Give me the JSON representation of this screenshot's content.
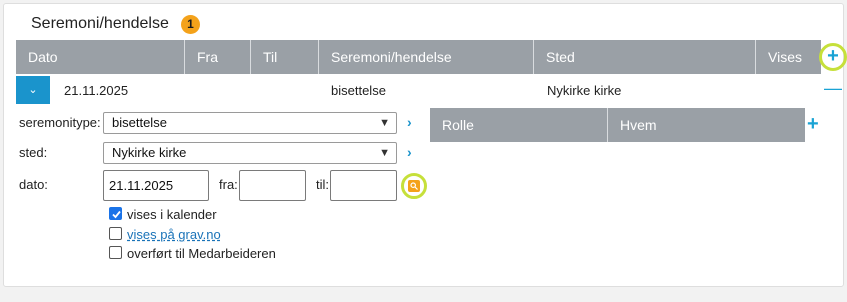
{
  "section": {
    "title": "Seremoni/hendelse",
    "badge": "1"
  },
  "table": {
    "columns": [
      "Dato",
      "Fra",
      "Til",
      "Seremoni/hendelse",
      "Sted",
      "Vises"
    ],
    "add_icon": "plus-icon",
    "row": {
      "dato": "21.11.2025",
      "fra": "",
      "til": "",
      "seremoni": "bisettelse",
      "sted": "Nykirke kirke",
      "expand_icon": "chevron-down-icon",
      "collapse_icon": "minus-icon"
    }
  },
  "form": {
    "seremonitype_label": "seremonitype:",
    "seremonitype_value": "bisettelse",
    "sted_label": "sted:",
    "sted_value": "Nykirke kirke",
    "dato_label": "dato:",
    "dato_value": "21.11.2025",
    "fra_label": "fra:",
    "fra_value": "",
    "til_label": "til:",
    "til_value": "",
    "checkboxes": {
      "kalender_label": "vises i kalender",
      "kalender_checked": true,
      "grav_label": "vises på grav.no",
      "grav_checked": false,
      "medarbeider_label": "overført til Medarbeideren",
      "medarbeider_checked": false
    }
  },
  "roles": {
    "columns": [
      "Rolle",
      "Hvem"
    ],
    "add_icon": "plus-icon"
  },
  "colors": {
    "header_gray": "#9aa0a6",
    "accent_blue": "#1a94cc",
    "badge_orange": "#f4a21a",
    "highlight_green": "#c6e03a"
  }
}
